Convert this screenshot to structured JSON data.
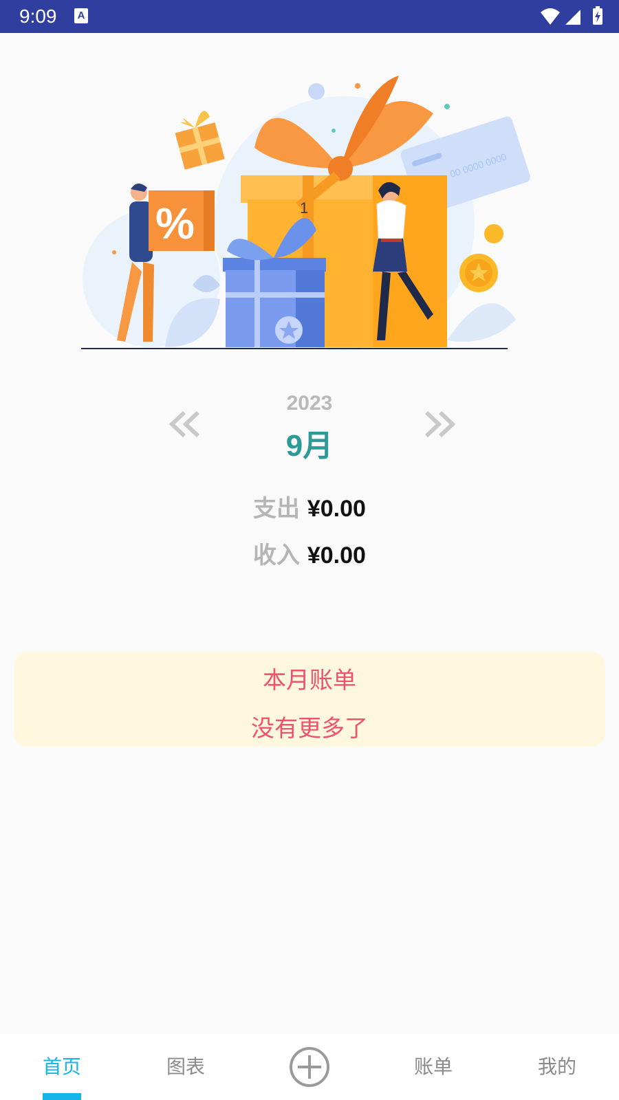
{
  "status_bar": {
    "time": "9:09",
    "notification_icon_letter": "A"
  },
  "hero": {
    "box_digit": "1",
    "card_number": "00 0000 0000"
  },
  "date_selector": {
    "year": "2023",
    "month": "9月",
    "prev_icon": "double-chevron-left-icon",
    "next_icon": "double-chevron-right-icon"
  },
  "summary": {
    "expense_label": "支出",
    "expense_value": "¥0.00",
    "income_label": "收入",
    "income_value": "¥0.00"
  },
  "bill_card": {
    "title": "本月账单",
    "empty_text": "没有更多了"
  },
  "tabbar": {
    "tabs": [
      "首页",
      "图表",
      "账单",
      "我的"
    ],
    "active_index": 0,
    "add_icon": "plus-circle-icon"
  },
  "colors": {
    "status_bar": "#303f9f",
    "accent": "#14b3e8",
    "month": "#2e9a97",
    "bill_text": "#f0526b",
    "bill_bg": "#fff8df"
  }
}
